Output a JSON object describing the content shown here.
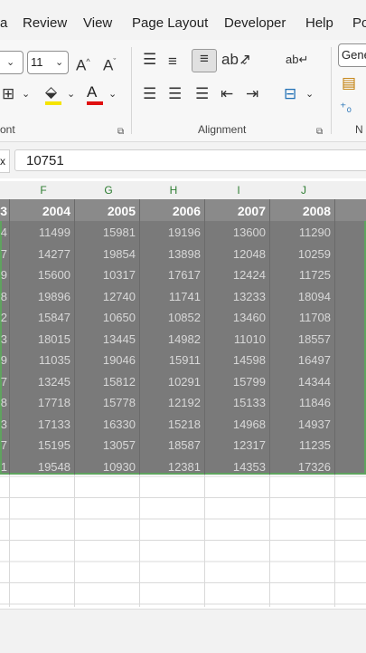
{
  "ribbon_tabs": [
    "a",
    "Review",
    "View",
    "Page Layout",
    "Developer",
    "Help",
    "Po"
  ],
  "font_group": {
    "font_name_tail": "",
    "font_size": "11",
    "label": "ont",
    "icons": [
      "increase-font-icon",
      "decrease-font-icon",
      "borders-icon",
      "fill-color-icon",
      "font-color-icon"
    ]
  },
  "alignment_group": {
    "label": "Alignment",
    "icons": [
      "align-top-icon",
      "align-middle-icon",
      "align-bottom-icon",
      "orientation-icon",
      "align-left-icon",
      "align-center-icon",
      "align-right-icon",
      "decrease-indent-icon",
      "increase-indent-icon",
      "wrap-text-icon",
      "merge-center-icon"
    ]
  },
  "number_group": {
    "format": "Gene",
    "label": "N"
  },
  "formula_bar": {
    "fx_label": "x",
    "value": "10751"
  },
  "column_letters": [
    "F",
    "G",
    "H",
    "I",
    "J"
  ],
  "year_headers": {
    "partial": "3",
    "years": [
      "2004",
      "2005",
      "2006",
      "2007",
      "2008"
    ]
  },
  "rows": [
    {
      "partial": "4",
      "values": [
        "11499",
        "15981",
        "19196",
        "13600",
        "11290"
      ]
    },
    {
      "partial": "7",
      "values": [
        "14277",
        "19854",
        "13898",
        "12048",
        "10259"
      ]
    },
    {
      "partial": "9",
      "values": [
        "15600",
        "10317",
        "17617",
        "12424",
        "11725"
      ]
    },
    {
      "partial": "8",
      "values": [
        "19896",
        "12740",
        "11741",
        "13233",
        "18094"
      ]
    },
    {
      "partial": "2",
      "values": [
        "15847",
        "10650",
        "10852",
        "13460",
        "11708"
      ]
    },
    {
      "partial": "3",
      "values": [
        "18015",
        "13445",
        "14982",
        "11010",
        "18557"
      ]
    },
    {
      "partial": "9",
      "values": [
        "11035",
        "19046",
        "15911",
        "14598",
        "16497"
      ]
    },
    {
      "partial": "7",
      "values": [
        "13245",
        "15812",
        "10291",
        "15799",
        "14344"
      ]
    },
    {
      "partial": "8",
      "values": [
        "17718",
        "15778",
        "12192",
        "15133",
        "11846"
      ]
    },
    {
      "partial": "3",
      "values": [
        "17133",
        "16330",
        "15218",
        "14968",
        "14937"
      ]
    },
    {
      "partial": "7",
      "values": [
        "15195",
        "13057",
        "18587",
        "12317",
        "11235"
      ]
    },
    {
      "partial": "1",
      "values": [
        "19548",
        "10930",
        "12381",
        "14353",
        "17326"
      ]
    }
  ]
}
